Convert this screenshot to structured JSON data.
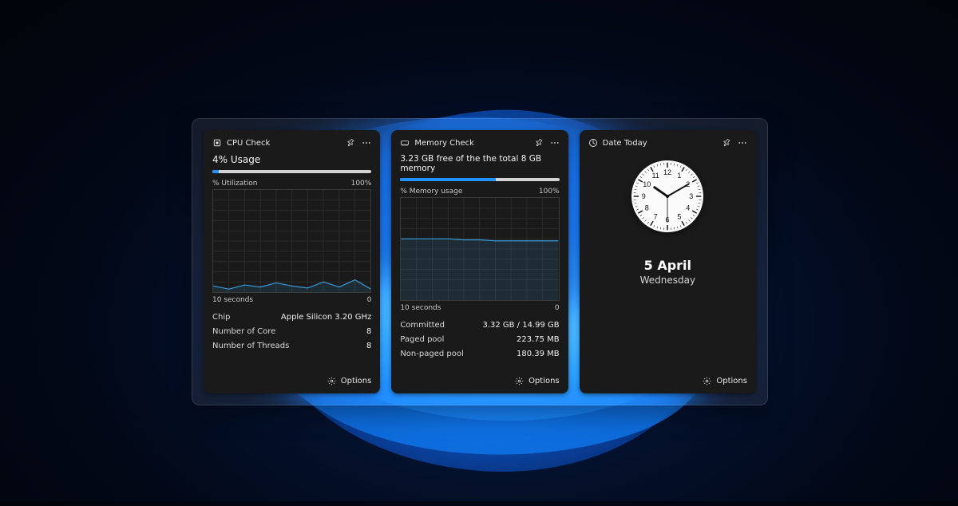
{
  "widgets": {
    "cpu": {
      "title": "CPU Check",
      "headline": "4% Usage",
      "progress_percent": 4,
      "chart_label_left": "% Utilization",
      "chart_label_right": "100%",
      "axis_left": "10 seconds",
      "axis_right": "0",
      "rows": [
        {
          "k": "Chip",
          "v": "Apple Silicon 3.20 GHz"
        },
        {
          "k": "Number of Core",
          "v": "8"
        },
        {
          "k": "Number of Threads",
          "v": "8"
        }
      ]
    },
    "memory": {
      "title": "Memory Check",
      "headline": "3.23 GB free of the the total 8 GB memory",
      "progress_percent": 60,
      "chart_label_left": "% Memory usage",
      "chart_label_right": "100%",
      "axis_left": "10 seconds",
      "axis_right": "0",
      "rows": [
        {
          "k": "Committed",
          "v": "3.32 GB / 14.99 GB"
        },
        {
          "k": "Paged pool",
          "v": "223.75 MB"
        },
        {
          "k": "Non-paged pool",
          "v": "180.39 MB"
        }
      ]
    },
    "date": {
      "title": "Date Today",
      "date_main": "5 April",
      "date_sub": "Wednesday",
      "clock": {
        "hour": 10,
        "minute": 10,
        "second": 30
      }
    }
  },
  "common": {
    "options_label": "Options"
  },
  "chart_data": [
    {
      "type": "line",
      "title": "% Utilization",
      "xlabel": "seconds ago",
      "ylabel": "% Utilization",
      "ylim": [
        0,
        100
      ],
      "x": [
        10,
        9,
        8,
        7,
        6,
        5,
        4,
        3,
        2,
        1,
        0
      ],
      "values": [
        6,
        3,
        7,
        5,
        9,
        6,
        4,
        10,
        5,
        12,
        3
      ]
    },
    {
      "type": "line",
      "title": "% Memory usage",
      "xlabel": "seconds ago",
      "ylabel": "% Memory usage",
      "ylim": [
        0,
        100
      ],
      "x": [
        10,
        9,
        8,
        7,
        6,
        5,
        4,
        3,
        2,
        1,
        0
      ],
      "values": [
        60,
        60,
        60,
        60,
        59,
        59,
        58,
        58,
        58,
        58,
        58
      ]
    }
  ]
}
